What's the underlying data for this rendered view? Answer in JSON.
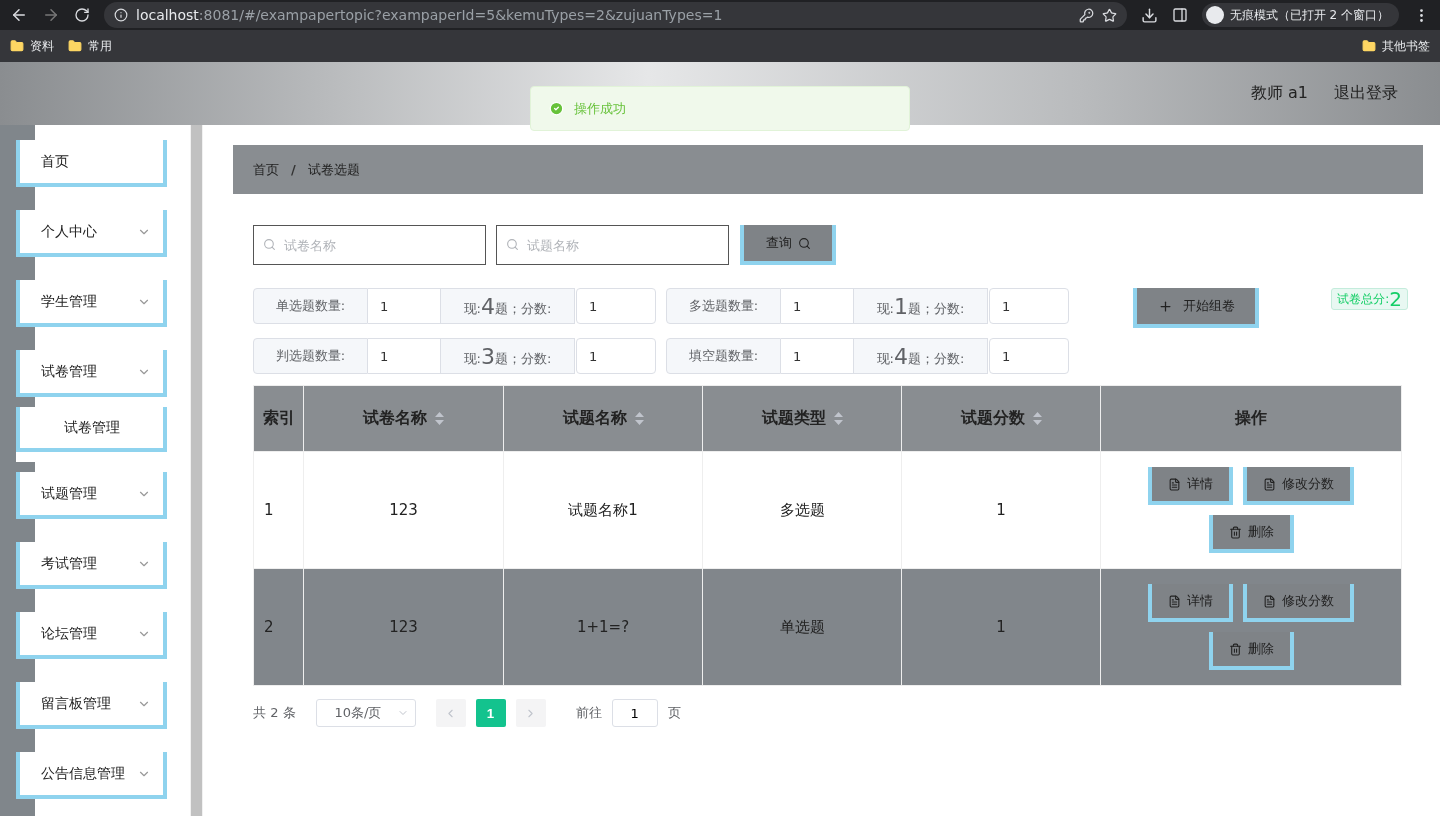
{
  "browser": {
    "url_host": "localhost",
    "url_rest": ":8081/#/exampapertopic?exampaperId=5&kemuTypes=2&zujuanTypes=1",
    "profile": "无痕模式（已打开 2 个窗口）",
    "bookmarks": [
      "资料",
      "常用"
    ],
    "other_bookmarks": "其他书签"
  },
  "header": {
    "user": "教师 a1",
    "logout": "退出登录"
  },
  "toast": {
    "message": "操作成功"
  },
  "sidebar": {
    "items": [
      {
        "label": "首页",
        "kind": "link"
      },
      {
        "label": "个人中心",
        "kind": "menu"
      },
      {
        "label": "学生管理",
        "kind": "menu"
      },
      {
        "label": "试卷管理",
        "kind": "menu",
        "children": [
          {
            "label": "试卷管理"
          }
        ]
      },
      {
        "label": "试题管理",
        "kind": "menu"
      },
      {
        "label": "考试管理",
        "kind": "menu"
      },
      {
        "label": "论坛管理",
        "kind": "menu"
      },
      {
        "label": "留言板管理",
        "kind": "menu"
      },
      {
        "label": "公告信息管理",
        "kind": "menu"
      }
    ]
  },
  "breadcrumb": [
    "首页",
    "试卷选题"
  ],
  "breadcrumb_separator": "/",
  "search": {
    "fields": [
      {
        "placeholder": "试卷名称"
      },
      {
        "placeholder": "试题名称"
      }
    ],
    "button": "查询"
  },
  "counts": [
    {
      "label": "单选题数量:",
      "value": "1",
      "now": "现:",
      "count": "4",
      "unit": "题；分数:",
      "score": "1"
    },
    {
      "label": "多选题数量:",
      "value": "1",
      "now": "现:",
      "count": "1",
      "unit": "题；分数:",
      "score": "1"
    },
    {
      "label": "判选题数量:",
      "value": "1",
      "now": "现:",
      "count": "3",
      "unit": "题；分数:",
      "score": "1"
    },
    {
      "label": "填空题数量:",
      "value": "1",
      "now": "现:",
      "count": "4",
      "unit": "题；分数:",
      "score": "1"
    }
  ],
  "compose_button": "开始组卷",
  "total": {
    "label": "试卷总分:",
    "value": "2"
  },
  "table": {
    "columns": [
      {
        "label": "索引",
        "sortable": false
      },
      {
        "label": "试卷名称",
        "sortable": true
      },
      {
        "label": "试题名称",
        "sortable": true
      },
      {
        "label": "试题类型",
        "sortable": true
      },
      {
        "label": "试题分数",
        "sortable": true
      },
      {
        "label": "操作",
        "sortable": false
      }
    ],
    "rows": [
      {
        "index": "1",
        "paper": "123",
        "topic": "试题名称1",
        "type": "多选题",
        "score": "1",
        "selected": false,
        "actions": [
          {
            "label": "详情",
            "kind": "doc"
          },
          {
            "label": "修改分数",
            "kind": "doc"
          },
          {
            "label": "删除",
            "kind": "trash"
          }
        ]
      },
      {
        "index": "2",
        "paper": "123",
        "topic": "1+1=?",
        "type": "单选题",
        "score": "1",
        "selected": true,
        "actions": [
          {
            "label": "详情",
            "kind": "doc"
          },
          {
            "label": "修改分数",
            "kind": "doc"
          },
          {
            "label": "删除",
            "kind": "trash"
          }
        ]
      }
    ]
  },
  "pagination": {
    "total": "共 2 条",
    "page_size": "10条/页",
    "pages": [
      {
        "label": "1",
        "selected": true
      }
    ],
    "goto_label": "前往",
    "goto_value": "1",
    "goto_unit": "页"
  }
}
